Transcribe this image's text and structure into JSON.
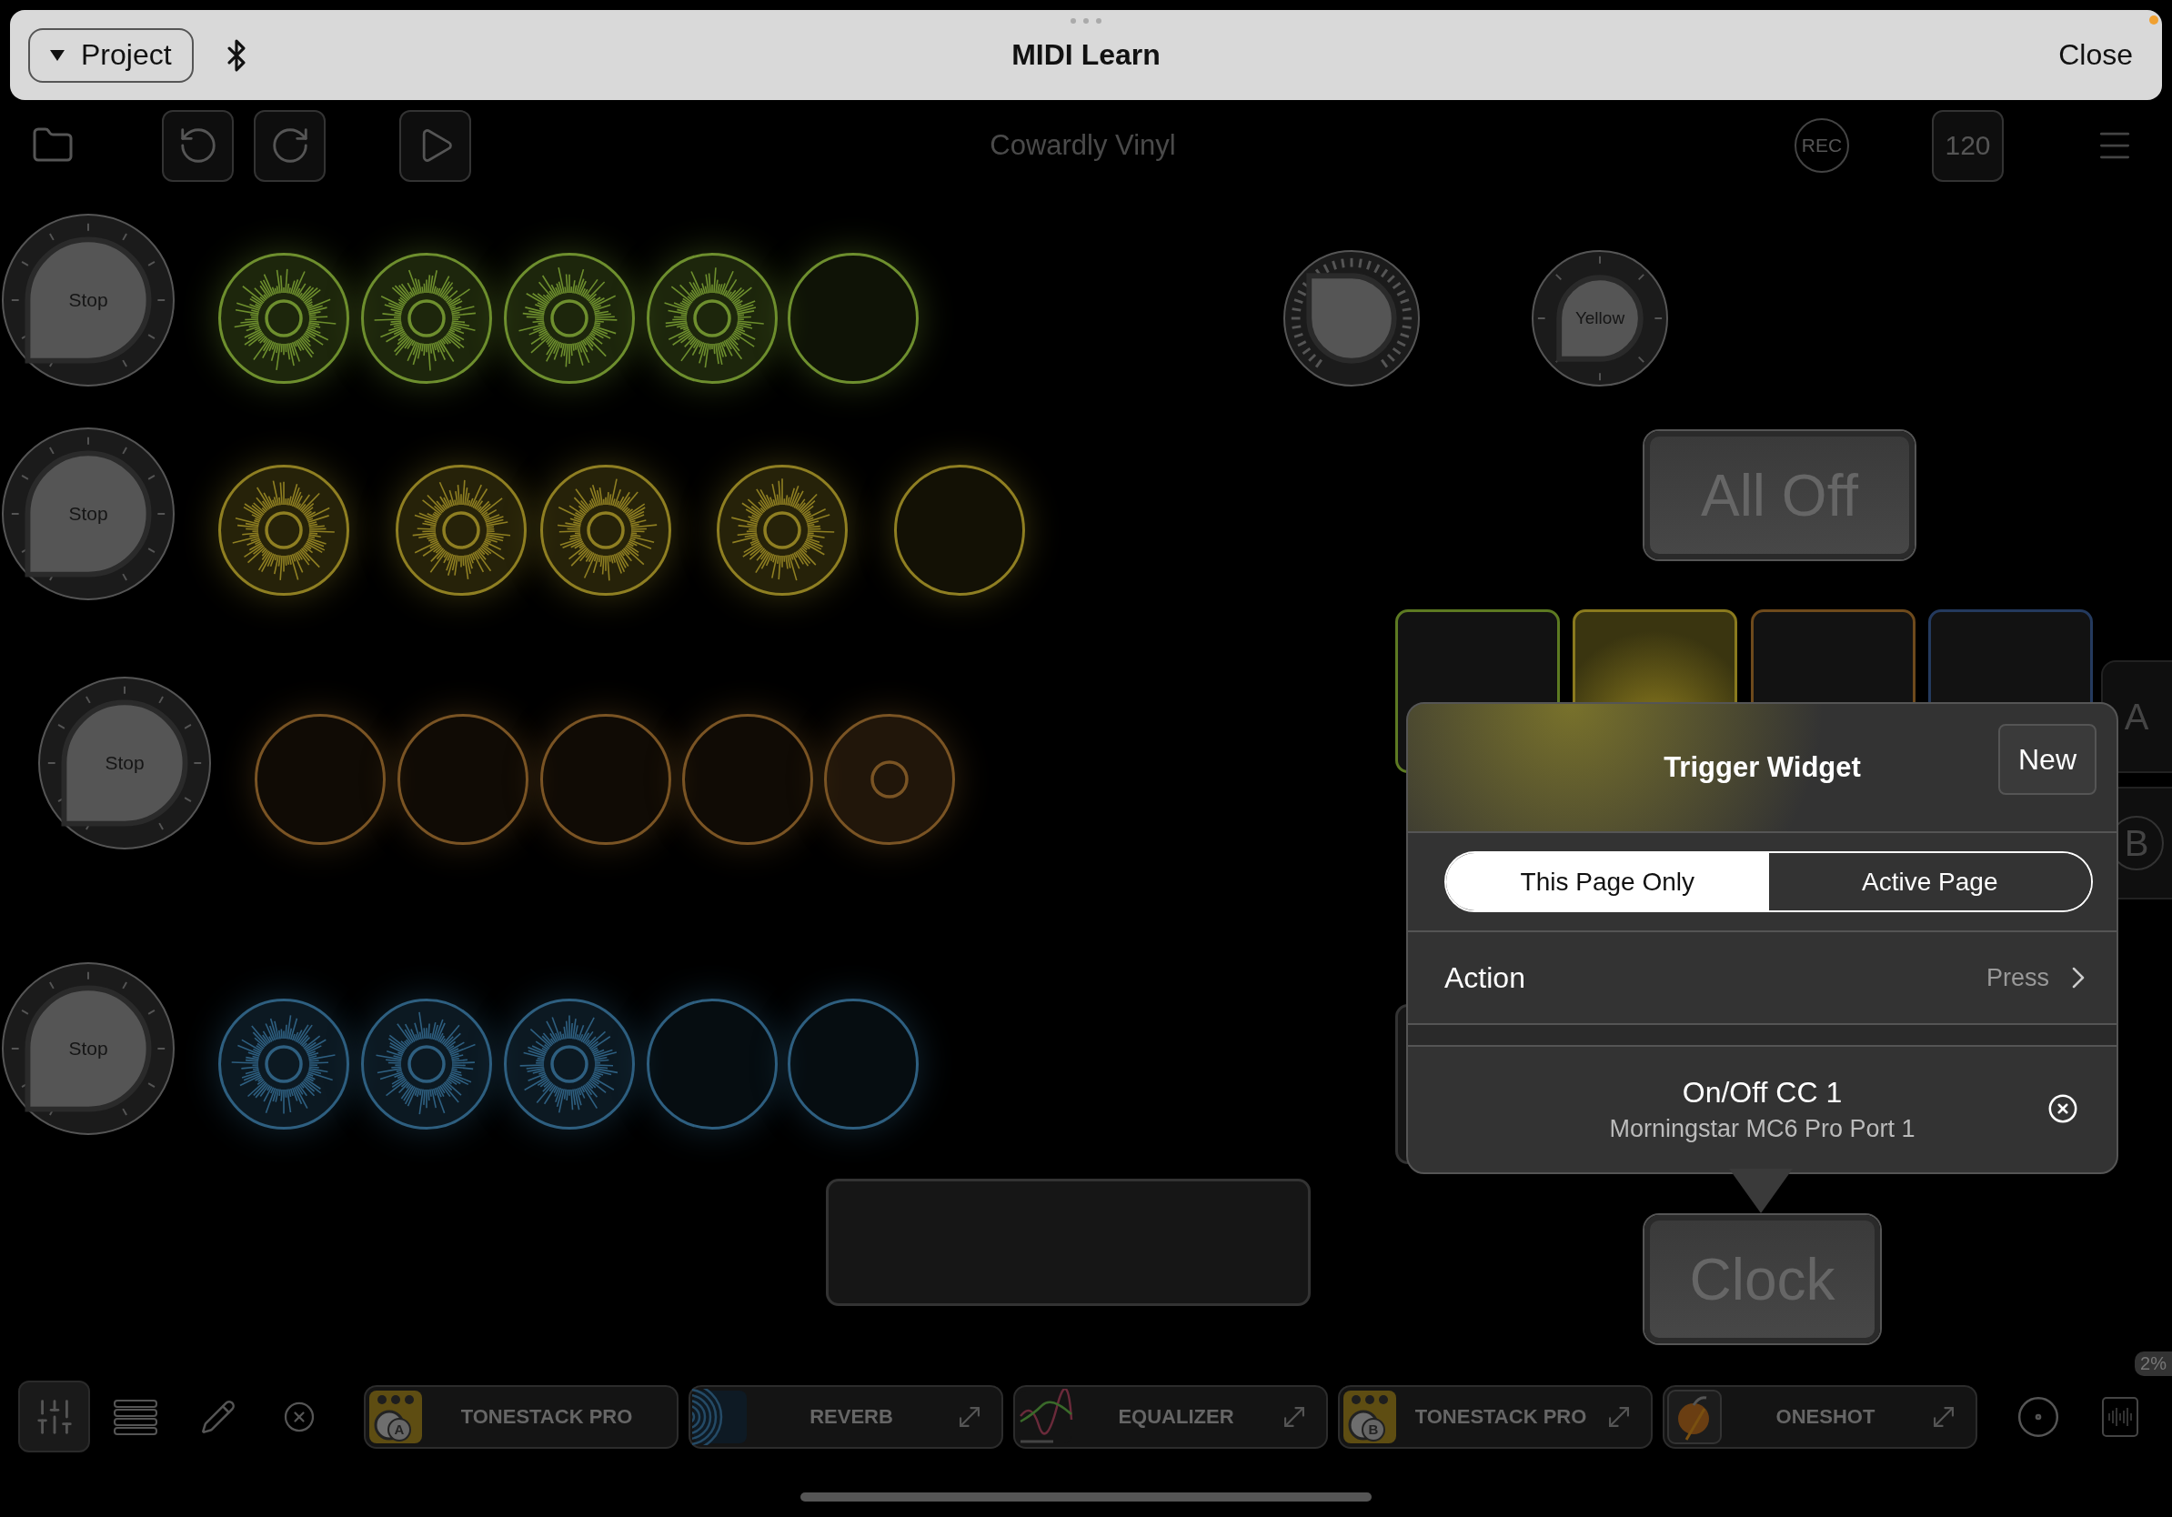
{
  "top_bar": {
    "project_button": "Project",
    "title": "MIDI Learn",
    "close_button": "Close"
  },
  "toolbar": {
    "song_title": "Cowardly Vinyl",
    "record_button": "REC",
    "tempo": "120"
  },
  "canvas": {
    "stop_knobs": [
      {
        "label": "Stop"
      },
      {
        "label": "Stop"
      },
      {
        "label": "Stop"
      },
      {
        "label": "Stop"
      }
    ],
    "clip_rows": [
      {
        "color": "#6e8f2e",
        "clips": [
          {
            "kind": "playing"
          },
          {
            "kind": "playing"
          },
          {
            "kind": "playing"
          },
          {
            "kind": "playing"
          },
          {
            "kind": "empty"
          }
        ]
      },
      {
        "color": "#8f7f22",
        "clips": [
          {
            "kind": "playing"
          },
          {
            "kind": "playing"
          },
          {
            "kind": "playing"
          },
          {
            "kind": "playing"
          },
          {
            "kind": "empty"
          }
        ]
      },
      {
        "color": "#7a5424",
        "clips": [
          {
            "kind": "empty"
          },
          {
            "kind": "empty"
          },
          {
            "kind": "empty"
          },
          {
            "kind": "empty"
          },
          {
            "kind": "queued"
          }
        ]
      },
      {
        "color": "#2e5f80",
        "clips": [
          {
            "kind": "playing"
          },
          {
            "kind": "playing"
          },
          {
            "kind": "playing"
          },
          {
            "kind": "empty"
          },
          {
            "kind": "empty"
          }
        ]
      }
    ],
    "knobs": [
      {
        "kind": "ticks"
      },
      {
        "kind": "labeled",
        "label": "Yellow"
      }
    ],
    "all_off_button": "All Off",
    "pads": [
      {
        "color": "#5d7a22",
        "lit": false
      },
      {
        "color": "#8a7a1e",
        "lit": true
      },
      {
        "color": "#6e4a1c",
        "lit": false
      },
      {
        "color": "#243a5e",
        "lit": false
      }
    ],
    "side_buttons": [
      {
        "label": "A",
        "kind": "plain"
      },
      {
        "label": "B",
        "kind": "circled"
      }
    ],
    "clock_button": "Clock"
  },
  "popover": {
    "title": "Trigger Widget",
    "new_button": "New",
    "scope_tabs": [
      {
        "label": "This Page Only",
        "selected": true
      },
      {
        "label": "Active Page",
        "selected": false
      }
    ],
    "action": {
      "label": "Action",
      "value": "Press"
    },
    "mapping": {
      "title": "On/Off CC 1",
      "subtitle": "Morningstar MC6 Pro Port 1"
    }
  },
  "bottom_bar": {
    "plugins": [
      {
        "name": "TONESTACK PRO",
        "kind": "amp",
        "badge": "A",
        "expandable": false
      },
      {
        "name": "REVERB",
        "kind": "reverb",
        "expandable": true
      },
      {
        "name": "EQUALIZER",
        "kind": "eq",
        "expandable": true
      },
      {
        "name": "TONESTACK PRO",
        "kind": "amp",
        "badge": "B",
        "expandable": true
      },
      {
        "name": "ONESHOT",
        "kind": "oneshot",
        "expandable": true
      }
    ],
    "cpu_badge": "2%"
  }
}
